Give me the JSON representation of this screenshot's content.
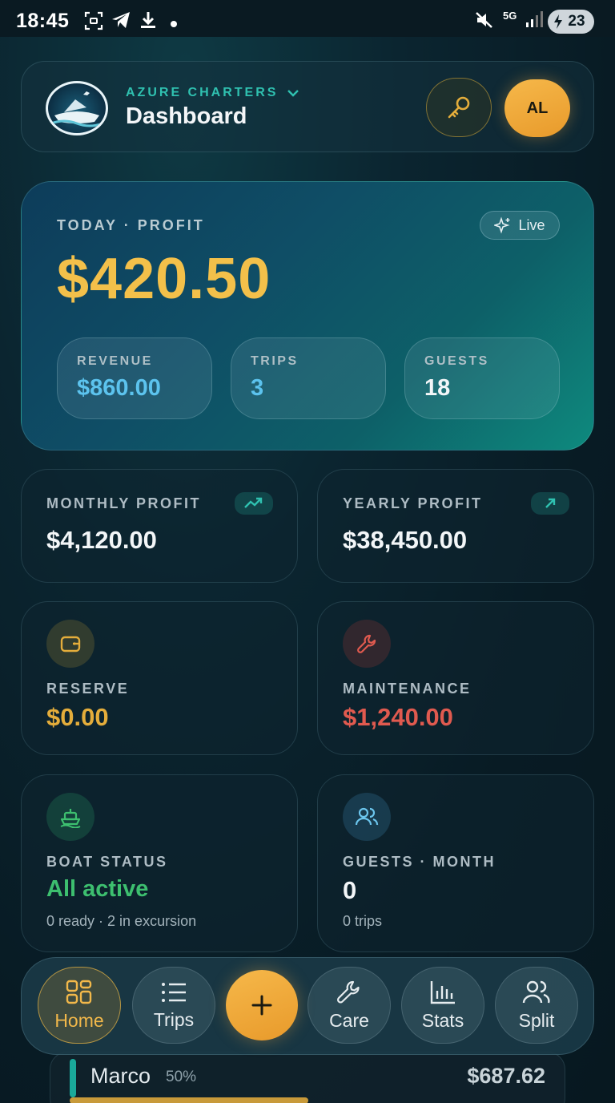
{
  "status_bar": {
    "time": "18:45",
    "network": "5G",
    "battery": "23",
    "icons": [
      "screenshot-icon",
      "telegram-icon",
      "download-icon",
      "dot-icon",
      "mute-icon",
      "signal-icon",
      "battery-icon"
    ]
  },
  "header": {
    "brand": "AZURE CHARTERS",
    "title": "Dashboard",
    "user_initials": "AL"
  },
  "hero": {
    "label": "TODAY · PROFIT",
    "live_label": "Live",
    "value": "$420.50",
    "stats": [
      {
        "label": "REVENUE",
        "value": "$860.00",
        "color": "#5cc3ee"
      },
      {
        "label": "TRIPS",
        "value": "3",
        "color": "#5cc3ee"
      },
      {
        "label": "GUESTS",
        "value": "18",
        "color": "#f3f6f8"
      }
    ]
  },
  "cards": {
    "monthly": {
      "label": "MONTHLY PROFIT",
      "value": "$4,120.00"
    },
    "yearly": {
      "label": "YEARLY PROFIT",
      "value": "$38,450.00"
    },
    "reserve": {
      "label": "RESERVE",
      "value": "$0.00"
    },
    "maintenance": {
      "label": "MAINTENANCE",
      "value": "$1,240.00"
    },
    "boat_status": {
      "label": "BOAT STATUS",
      "value": "All active",
      "sub": "0 ready · 2 in excursion"
    },
    "guests_month": {
      "label": "GUESTS · MONTH",
      "value": "0",
      "sub": "0 trips"
    }
  },
  "split_peek": {
    "name": "Marco",
    "percent": "50%",
    "amount": "$687.62"
  },
  "nav": {
    "items": [
      {
        "label": "Home"
      },
      {
        "label": "Trips"
      },
      {
        "label": "Care"
      },
      {
        "label": "Stats"
      },
      {
        "label": "Split"
      }
    ]
  },
  "colors": {
    "accent": "#f3c04a",
    "teal": "#2fc1b0",
    "danger": "#e05a4f",
    "success": "#3dbf6f"
  }
}
